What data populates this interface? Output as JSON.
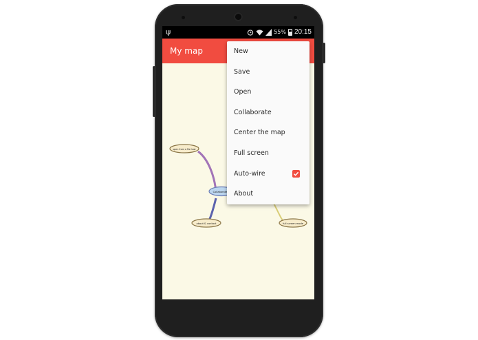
{
  "status_bar": {
    "battery_percent": "55%",
    "time": "20:15",
    "icons": [
      "usb-icon",
      "alarm-icon",
      "wifi-icon",
      "signal-icon",
      "battery-icon"
    ]
  },
  "app_bar": {
    "title": "My map"
  },
  "menu": {
    "items": [
      {
        "label": "New"
      },
      {
        "label": "Save"
      },
      {
        "label": "Open"
      },
      {
        "label": "Collaborate"
      },
      {
        "label": "Center the map"
      },
      {
        "label": "Full screen"
      },
      {
        "label": "Auto-wire",
        "checked": true
      },
      {
        "label": "About"
      }
    ]
  },
  "mind_map": {
    "nodes": [
      {
        "label": "open from a file host"
      },
      {
        "label": "Collaborate"
      },
      {
        "label": "about & contact"
      },
      {
        "label": "full screen mode"
      }
    ]
  },
  "colors": {
    "accent": "#f14c40",
    "canvas": "#fbf9e6",
    "status_bar": "#000000",
    "node_fill": "#f7eccb",
    "center_node_fill": "#bcd6ef"
  }
}
